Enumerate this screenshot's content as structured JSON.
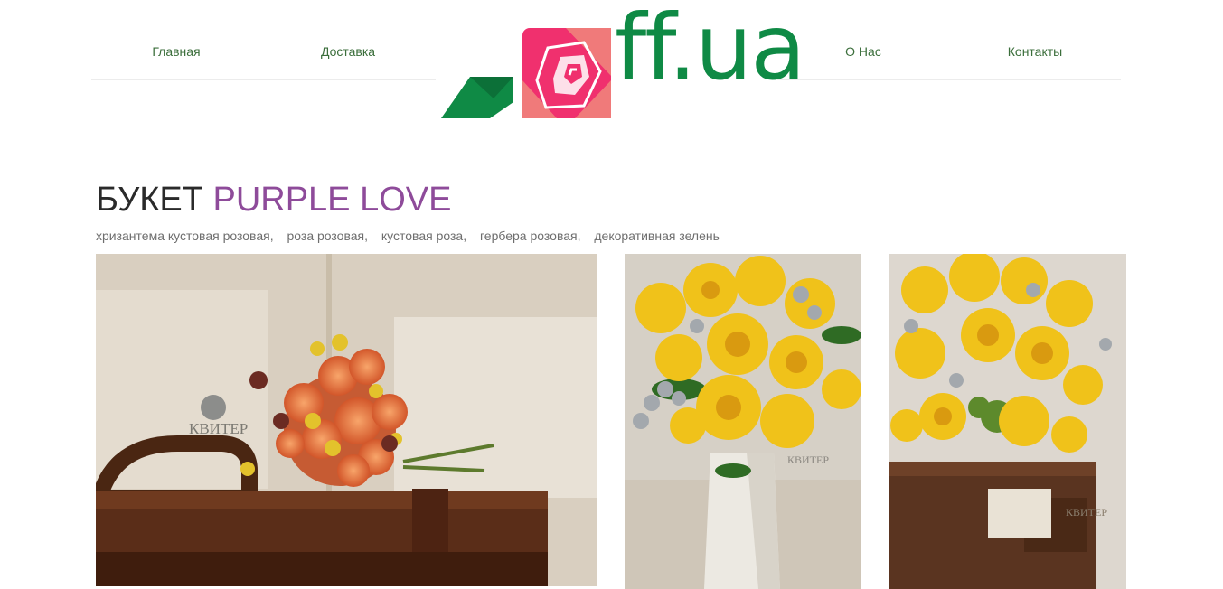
{
  "nav": {
    "home": "Главная",
    "delivery": "Доставка",
    "about": "О Нас",
    "contacts": "Контакты"
  },
  "logo": {
    "text": "ff.ua",
    "colors": {
      "green": "#0f8a45",
      "pink": "#f0306e",
      "rose": "#f07a7a"
    }
  },
  "product": {
    "title_prefix": "БУКЕТ",
    "title_name": "PURPLE LOVE",
    "components": [
      "хризантема кустовая розовая,",
      "роза розовая,",
      "кустовая роза,",
      "гербера розовая,",
      "декоративная зелень"
    ]
  },
  "photos": {
    "watermark": "КВИТЕР"
  }
}
